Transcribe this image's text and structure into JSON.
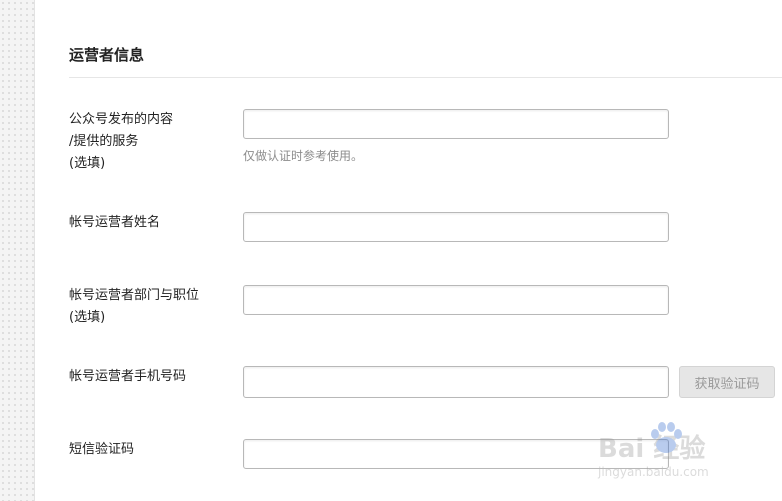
{
  "top_faded_text": "",
  "section": {
    "title": "运营者信息"
  },
  "fields": {
    "content": {
      "label_lines": [
        "公众号发布的内容",
        "/提供的服务",
        "(选填)"
      ],
      "value": "",
      "placeholder": "",
      "hint": "仅做认证时参考使用。"
    },
    "name": {
      "label_lines": [
        "帐号运营者姓名"
      ],
      "value": "",
      "placeholder": ""
    },
    "department": {
      "label_lines": [
        "帐号运营者部门与职位",
        "(选填)"
      ],
      "value": "",
      "placeholder": ""
    },
    "phone": {
      "label_lines": [
        "帐号运营者手机号码"
      ],
      "value": "",
      "placeholder": "",
      "button_label": "获取验证码"
    },
    "sms_code": {
      "label_lines": [
        "短信验证码"
      ],
      "value": "",
      "placeholder": ""
    }
  },
  "watermark": {
    "brand_text": "Bai 经验",
    "url": "jingyan.baidu.com"
  },
  "colors": {
    "button_bg": "#e6e6e6",
    "button_text": "#9a9a9a",
    "hint_text": "#8c8c8c",
    "border": "#b8b8b8"
  },
  "icons": {
    "watermark_logo": "baidu-paw-icon"
  }
}
